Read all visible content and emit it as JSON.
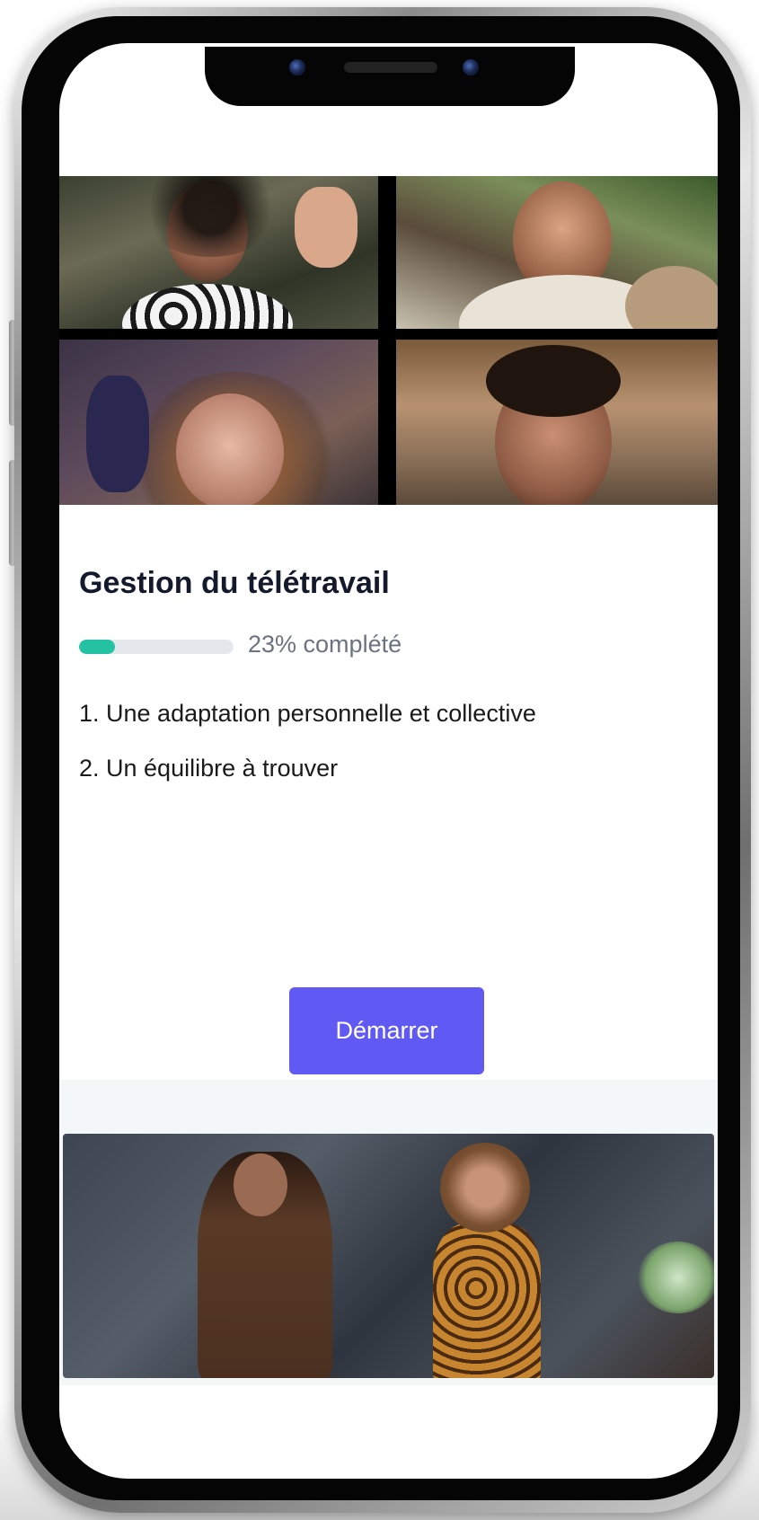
{
  "course": {
    "title": "Gestion du télétravail",
    "progress_percent": 23,
    "progress_label": "23% complété",
    "chapters": [
      "1. Une adaptation personnelle et collective",
      "2. Un équilibre à trouver"
    ],
    "start_label": "Démarrer"
  },
  "colors": {
    "accent_button": "#6159f3",
    "progress_fill": "#24c1a3",
    "progress_track": "#e4e7ec",
    "title_text": "#141a2c"
  },
  "icons": [
    "front-camera-icon",
    "earpiece-speaker-icon"
  ]
}
